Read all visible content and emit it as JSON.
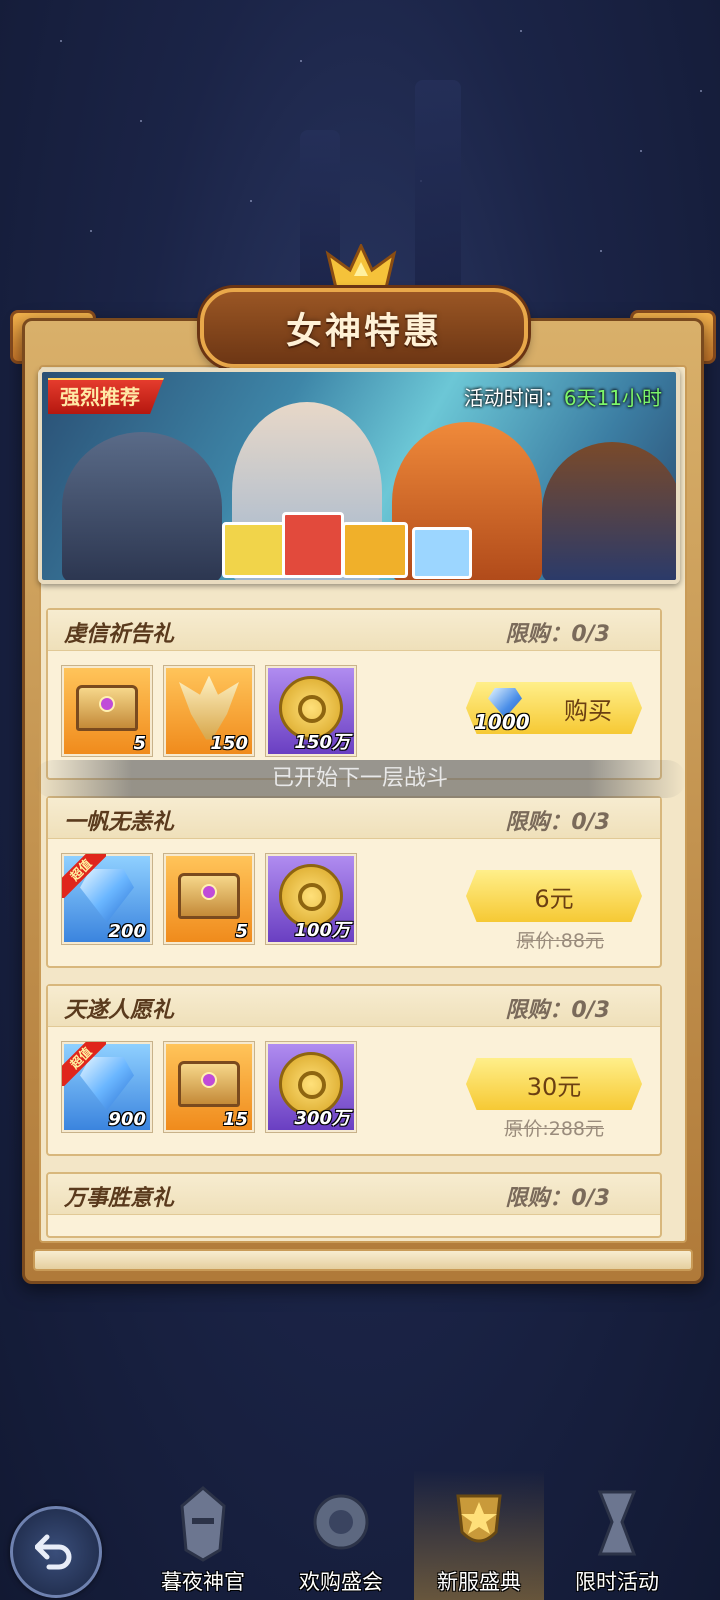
{
  "title": "女神特惠",
  "banner": {
    "tag": "强烈推荐",
    "time_label": "活动时间：",
    "time_value": "6天11小时"
  },
  "toast": "已开始下一层战斗",
  "gifts": [
    {
      "name": "虔信祈告礼",
      "limit": "限购：0/3",
      "items": [
        {
          "icon": "chest-icon",
          "count": "5"
        },
        {
          "icon": "phoenix-wing-icon",
          "count": "150"
        },
        {
          "icon": "gold-coin-icon",
          "count": "150万"
        }
      ],
      "button": {
        "type": "diamond",
        "cost": "1000",
        "label": "购买"
      }
    },
    {
      "name": "一帆无恙礼",
      "limit": "限购：0/3",
      "items": [
        {
          "icon": "diamond-icon",
          "count": "200",
          "badge": "超值"
        },
        {
          "icon": "chest-icon",
          "count": "5"
        },
        {
          "icon": "gold-coin-icon",
          "count": "100万"
        }
      ],
      "button": {
        "type": "price",
        "label": "6元",
        "original": "原价:88元"
      }
    },
    {
      "name": "天遂人愿礼",
      "limit": "限购：0/3",
      "items": [
        {
          "icon": "diamond-icon",
          "count": "900",
          "badge": "超值"
        },
        {
          "icon": "chest-icon",
          "count": "15"
        },
        {
          "icon": "gold-coin-icon",
          "count": "300万"
        }
      ],
      "button": {
        "type": "price",
        "label": "30元",
        "original": "原价:288元"
      }
    },
    {
      "name": "万事胜意礼",
      "limit": "限购：0/3"
    }
  ],
  "nav": [
    {
      "label": "暮夜神官",
      "icon": "knight-helmet-icon",
      "active": false
    },
    {
      "label": "欢购盛会",
      "icon": "shield-emblem-icon",
      "active": false
    },
    {
      "label": "新服盛典",
      "icon": "star-trophy-icon",
      "active": true
    },
    {
      "label": "限时活动",
      "icon": "hourglass-icon",
      "active": false
    }
  ],
  "colors": {
    "accent_gold": "#f6c934",
    "timer_green": "#7cf56a",
    "badge_red": "#e0261b"
  }
}
